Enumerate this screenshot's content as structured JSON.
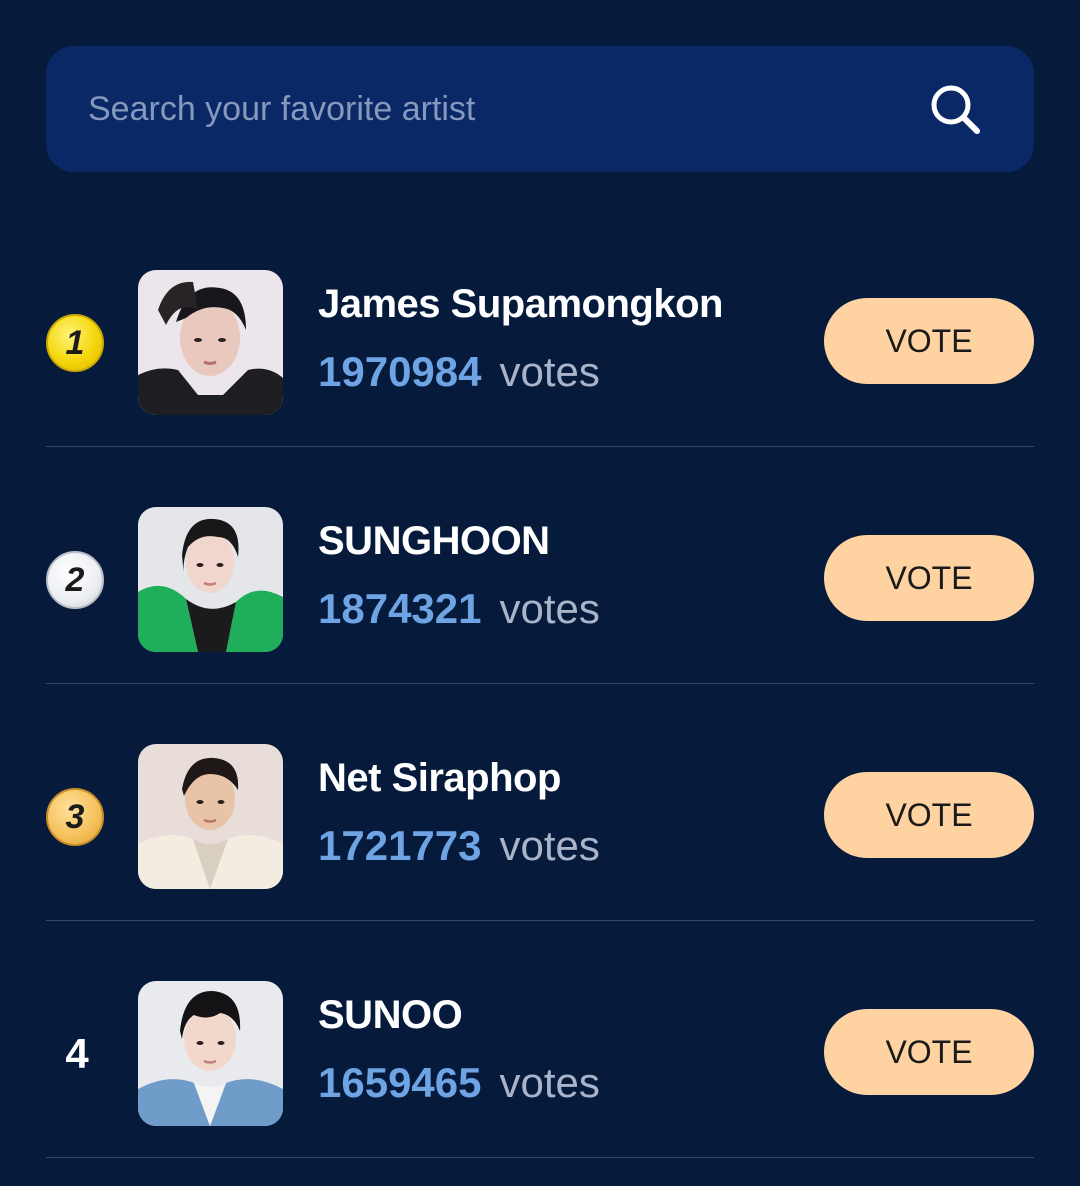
{
  "search": {
    "placeholder": "Search your favorite artist",
    "icon": "search-icon"
  },
  "colors": {
    "background": "#061b3c",
    "search_bg": "#0a2866",
    "vote_count": "#6ea4e4",
    "vote_button": "#ffd3a1",
    "gold": "#f6d70c",
    "silver": "#eceef2",
    "bronze": "#f5c05a"
  },
  "ranking": [
    {
      "rank": "1",
      "medal": "gold",
      "name": "James Supamongkon",
      "votes": "1970984",
      "votes_label": "votes",
      "vote_button": "VOTE"
    },
    {
      "rank": "2",
      "medal": "silver",
      "name": "SUNGHOON",
      "votes": "1874321",
      "votes_label": "votes",
      "vote_button": "VOTE"
    },
    {
      "rank": "3",
      "medal": "bronze",
      "name": "Net Siraphop",
      "votes": "1721773",
      "votes_label": "votes",
      "vote_button": "VOTE"
    },
    {
      "rank": "4",
      "medal": "none",
      "name": "SUNOO",
      "votes": "1659465",
      "votes_label": "votes",
      "vote_button": "VOTE"
    }
  ]
}
